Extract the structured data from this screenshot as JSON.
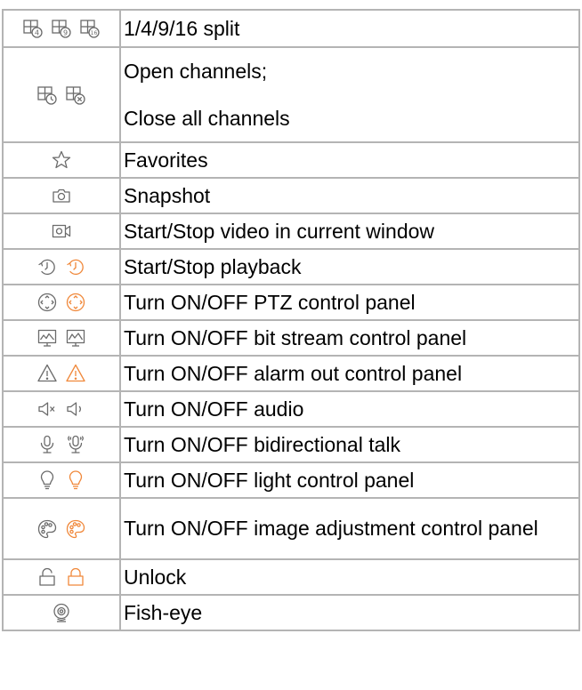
{
  "colors": {
    "icon_gray": "#6b6b6b",
    "icon_orange": "#f0883a",
    "border": "#b4b4b4",
    "text": "#000000"
  },
  "rows": [
    {
      "icons": [
        "split-4-icon",
        "split-9-icon",
        "split-16-icon"
      ],
      "text": "1/4/9/16 split"
    },
    {
      "icons": [
        "open-channels-icon",
        "close-channels-icon"
      ],
      "text_line1": "Open channels;",
      "text_line2": "Close all channels"
    },
    {
      "icons": [
        "star-icon"
      ],
      "text": "Favorites"
    },
    {
      "icons": [
        "camera-icon"
      ],
      "text": "Snapshot"
    },
    {
      "icons": [
        "video-camera-icon"
      ],
      "text": "Start/Stop video in current window"
    },
    {
      "icons": [
        "playback-icon",
        "playback-active-icon"
      ],
      "text": "Start/Stop playback"
    },
    {
      "icons": [
        "ptz-icon",
        "ptz-active-icon"
      ],
      "text": "Turn ON/OFF PTZ control panel"
    },
    {
      "icons": [
        "bitstream-icon",
        "bitstream-alt-icon"
      ],
      "text": "Turn ON/OFF bit stream  control panel"
    },
    {
      "icons": [
        "alarm-icon",
        "alarm-active-icon"
      ],
      "text": "Turn ON/OFF alarm out control panel"
    },
    {
      "icons": [
        "audio-muted-icon",
        "audio-icon"
      ],
      "text": "Turn ON/OFF audio"
    },
    {
      "icons": [
        "microphone-icon",
        "microphone-active-icon"
      ],
      "text": "Turn ON/OFF bidirectional talk"
    },
    {
      "icons": [
        "bulb-icon",
        "bulb-active-icon"
      ],
      "text": "Turn ON/OFF light control panel"
    },
    {
      "icons": [
        "palette-icon",
        "palette-active-icon"
      ],
      "text": "Turn ON/OFF image adjustment control panel"
    },
    {
      "icons": [
        "lock-icon",
        "lock-open-icon"
      ],
      "text": "Unlock"
    },
    {
      "icons": [
        "fisheye-icon"
      ],
      "text": "Fish-eye"
    }
  ]
}
